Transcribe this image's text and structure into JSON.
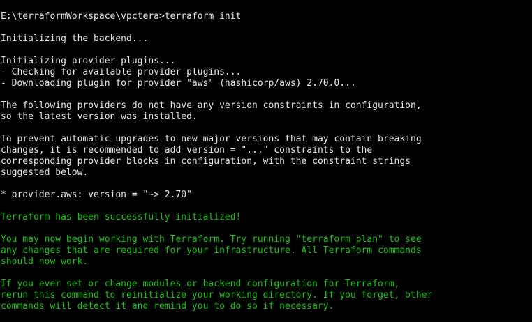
{
  "colors": {
    "background": "#000000",
    "default_text": "#e6e6e6",
    "success_text": "#16c60c"
  },
  "console": {
    "lines": [
      {
        "text": "E:\\terraformWorkspace\\vpctera>terraform init",
        "color": "white"
      },
      {
        "text": "",
        "color": "white"
      },
      {
        "text": "Initializing the backend...",
        "color": "white"
      },
      {
        "text": "",
        "color": "white"
      },
      {
        "text": "Initializing provider plugins...",
        "color": "white"
      },
      {
        "text": "- Checking for available provider plugins...",
        "color": "white"
      },
      {
        "text": "- Downloading plugin for provider \"aws\" (hashicorp/aws) 2.70.0...",
        "color": "white"
      },
      {
        "text": "",
        "color": "white"
      },
      {
        "text": "The following providers do not have any version constraints in configuration,",
        "color": "white"
      },
      {
        "text": "so the latest version was installed.",
        "color": "white"
      },
      {
        "text": "",
        "color": "white"
      },
      {
        "text": "To prevent automatic upgrades to new major versions that may contain breaking",
        "color": "white"
      },
      {
        "text": "changes, it is recommended to add version = \"...\" constraints to the",
        "color": "white"
      },
      {
        "text": "corresponding provider blocks in configuration, with the constraint strings",
        "color": "white"
      },
      {
        "text": "suggested below.",
        "color": "white"
      },
      {
        "text": "",
        "color": "white"
      },
      {
        "text": "* provider.aws: version = \"~> 2.70\"",
        "color": "white"
      },
      {
        "text": "",
        "color": "white"
      },
      {
        "text": "Terraform has been successfully initialized!",
        "color": "green"
      },
      {
        "text": "",
        "color": "green"
      },
      {
        "text": "You may now begin working with Terraform. Try running \"terraform plan\" to see",
        "color": "green"
      },
      {
        "text": "any changes that are required for your infrastructure. All Terraform commands",
        "color": "green"
      },
      {
        "text": "should now work.",
        "color": "green"
      },
      {
        "text": "",
        "color": "green"
      },
      {
        "text": "If you ever set or change modules or backend configuration for Terraform,",
        "color": "green"
      },
      {
        "text": "rerun this command to reinitialize your working directory. If you forget, other",
        "color": "green"
      },
      {
        "text": "commands will detect it and remind you to do so if necessary.",
        "color": "green"
      }
    ]
  }
}
